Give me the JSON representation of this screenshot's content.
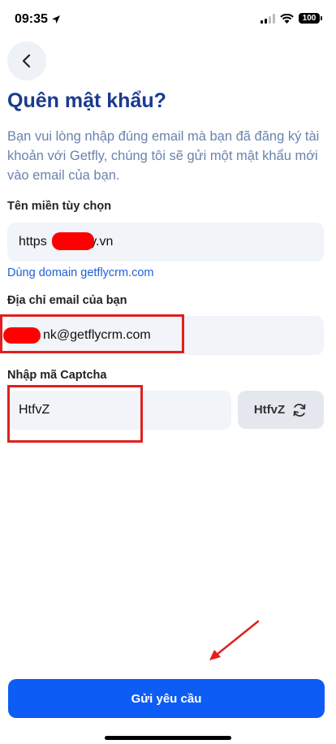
{
  "status_bar": {
    "time": "09:35",
    "battery": "100"
  },
  "header": {
    "title": "Quên mật khẩu?"
  },
  "description": "Bạn vui lòng nhập đúng email mà bạn đã đăng ký tài khoản với Getfly, chúng tôi sẽ gửi một mật khẩu mới vào email của bạn.",
  "domain_field": {
    "label": "Tên miền tùy chọn",
    "value_prefix": "https",
    "value_suffix": "ly.vn"
  },
  "domain_link": "Dùng domain getflycrm.com",
  "email_field": {
    "label": "Địa chỉ email của bạn",
    "value_suffix": "nk@getflycrm.com"
  },
  "captcha_field": {
    "label": "Nhập mã Captcha",
    "value": "HtfvZ",
    "captcha_code": "HtfvZ"
  },
  "submit_button": {
    "label": "Gửi yêu cầu"
  },
  "colors": {
    "title": "#1a3a8f",
    "primary": "#0d5cf5",
    "annotation": "#e02020"
  }
}
